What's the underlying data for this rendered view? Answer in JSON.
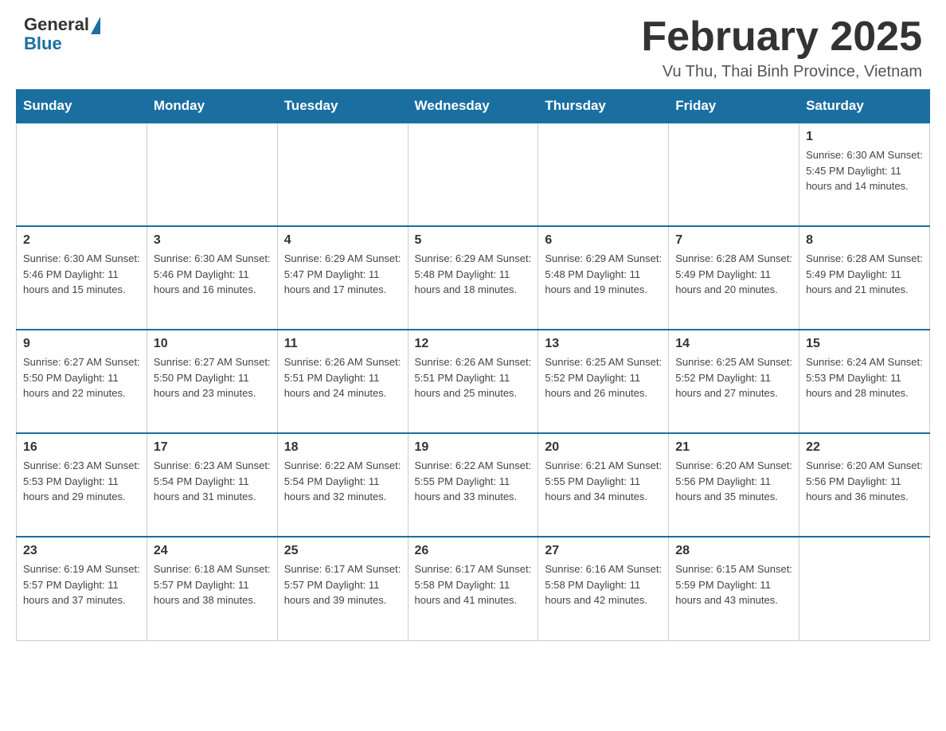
{
  "header": {
    "logo": {
      "general": "General",
      "blue": "Blue"
    },
    "title": "February 2025",
    "location": "Vu Thu, Thai Binh Province, Vietnam"
  },
  "days_of_week": [
    "Sunday",
    "Monday",
    "Tuesday",
    "Wednesday",
    "Thursday",
    "Friday",
    "Saturday"
  ],
  "weeks": [
    [
      {
        "day": "",
        "info": ""
      },
      {
        "day": "",
        "info": ""
      },
      {
        "day": "",
        "info": ""
      },
      {
        "day": "",
        "info": ""
      },
      {
        "day": "",
        "info": ""
      },
      {
        "day": "",
        "info": ""
      },
      {
        "day": "1",
        "info": "Sunrise: 6:30 AM\nSunset: 5:45 PM\nDaylight: 11 hours and 14 minutes."
      }
    ],
    [
      {
        "day": "2",
        "info": "Sunrise: 6:30 AM\nSunset: 5:46 PM\nDaylight: 11 hours and 15 minutes."
      },
      {
        "day": "3",
        "info": "Sunrise: 6:30 AM\nSunset: 5:46 PM\nDaylight: 11 hours and 16 minutes."
      },
      {
        "day": "4",
        "info": "Sunrise: 6:29 AM\nSunset: 5:47 PM\nDaylight: 11 hours and 17 minutes."
      },
      {
        "day": "5",
        "info": "Sunrise: 6:29 AM\nSunset: 5:48 PM\nDaylight: 11 hours and 18 minutes."
      },
      {
        "day": "6",
        "info": "Sunrise: 6:29 AM\nSunset: 5:48 PM\nDaylight: 11 hours and 19 minutes."
      },
      {
        "day": "7",
        "info": "Sunrise: 6:28 AM\nSunset: 5:49 PM\nDaylight: 11 hours and 20 minutes."
      },
      {
        "day": "8",
        "info": "Sunrise: 6:28 AM\nSunset: 5:49 PM\nDaylight: 11 hours and 21 minutes."
      }
    ],
    [
      {
        "day": "9",
        "info": "Sunrise: 6:27 AM\nSunset: 5:50 PM\nDaylight: 11 hours and 22 minutes."
      },
      {
        "day": "10",
        "info": "Sunrise: 6:27 AM\nSunset: 5:50 PM\nDaylight: 11 hours and 23 minutes."
      },
      {
        "day": "11",
        "info": "Sunrise: 6:26 AM\nSunset: 5:51 PM\nDaylight: 11 hours and 24 minutes."
      },
      {
        "day": "12",
        "info": "Sunrise: 6:26 AM\nSunset: 5:51 PM\nDaylight: 11 hours and 25 minutes."
      },
      {
        "day": "13",
        "info": "Sunrise: 6:25 AM\nSunset: 5:52 PM\nDaylight: 11 hours and 26 minutes."
      },
      {
        "day": "14",
        "info": "Sunrise: 6:25 AM\nSunset: 5:52 PM\nDaylight: 11 hours and 27 minutes."
      },
      {
        "day": "15",
        "info": "Sunrise: 6:24 AM\nSunset: 5:53 PM\nDaylight: 11 hours and 28 minutes."
      }
    ],
    [
      {
        "day": "16",
        "info": "Sunrise: 6:23 AM\nSunset: 5:53 PM\nDaylight: 11 hours and 29 minutes."
      },
      {
        "day": "17",
        "info": "Sunrise: 6:23 AM\nSunset: 5:54 PM\nDaylight: 11 hours and 31 minutes."
      },
      {
        "day": "18",
        "info": "Sunrise: 6:22 AM\nSunset: 5:54 PM\nDaylight: 11 hours and 32 minutes."
      },
      {
        "day": "19",
        "info": "Sunrise: 6:22 AM\nSunset: 5:55 PM\nDaylight: 11 hours and 33 minutes."
      },
      {
        "day": "20",
        "info": "Sunrise: 6:21 AM\nSunset: 5:55 PM\nDaylight: 11 hours and 34 minutes."
      },
      {
        "day": "21",
        "info": "Sunrise: 6:20 AM\nSunset: 5:56 PM\nDaylight: 11 hours and 35 minutes."
      },
      {
        "day": "22",
        "info": "Sunrise: 6:20 AM\nSunset: 5:56 PM\nDaylight: 11 hours and 36 minutes."
      }
    ],
    [
      {
        "day": "23",
        "info": "Sunrise: 6:19 AM\nSunset: 5:57 PM\nDaylight: 11 hours and 37 minutes."
      },
      {
        "day": "24",
        "info": "Sunrise: 6:18 AM\nSunset: 5:57 PM\nDaylight: 11 hours and 38 minutes."
      },
      {
        "day": "25",
        "info": "Sunrise: 6:17 AM\nSunset: 5:57 PM\nDaylight: 11 hours and 39 minutes."
      },
      {
        "day": "26",
        "info": "Sunrise: 6:17 AM\nSunset: 5:58 PM\nDaylight: 11 hours and 41 minutes."
      },
      {
        "day": "27",
        "info": "Sunrise: 6:16 AM\nSunset: 5:58 PM\nDaylight: 11 hours and 42 minutes."
      },
      {
        "day": "28",
        "info": "Sunrise: 6:15 AM\nSunset: 5:59 PM\nDaylight: 11 hours and 43 minutes."
      },
      {
        "day": "",
        "info": ""
      }
    ]
  ]
}
